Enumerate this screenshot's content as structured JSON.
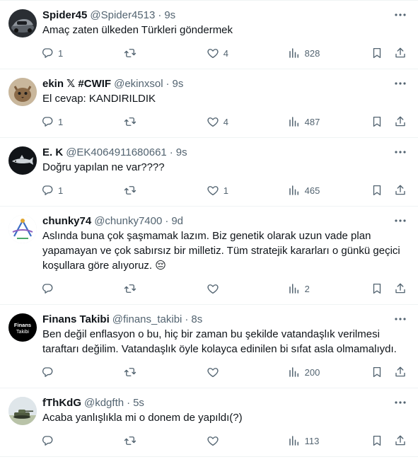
{
  "colors": {
    "text": "#0f1419",
    "secondary": "#536471",
    "divider": "#eff3f4"
  },
  "tweets": [
    {
      "name": "Spider45",
      "handle": "@Spider4513",
      "time": "9s",
      "text": "Amaç zaten ülkeden Türkleri göndermek",
      "replies": "1",
      "retweets": "",
      "likes": "4",
      "views": "828",
      "avatar_icon": "car-avatar"
    },
    {
      "name": "ekin 𝕏 #CWIF",
      "handle": "@ekinxsol",
      "time": "9s",
      "text": "El cevap: KANDIRILDIK",
      "replies": "1",
      "retweets": "",
      "likes": "4",
      "views": "487",
      "avatar_icon": "cat-avatar"
    },
    {
      "name": "E. K",
      "handle": "@EK4064911680661",
      "time": "9s",
      "text": "Doğru yapılan ne var????",
      "replies": "1",
      "retweets": "",
      "likes": "1",
      "views": "465",
      "avatar_icon": "shark-avatar"
    },
    {
      "name": "chunky74",
      "handle": "@chunky7400",
      "time": "9d",
      "text": "Aslında buna çok şaşmamak lazım. Biz genetik olarak uzun vade plan yapamayan ve çok sabırsız bir milletiz. Tüm stratejik kararları o günkü geçici koşullara göre alıyoruz. 😔",
      "replies": "",
      "retweets": "",
      "likes": "",
      "views": "2",
      "avatar_icon": "logo-avatar"
    },
    {
      "name": "Finans Takibi",
      "handle": "@finans_takibi",
      "time": "8s",
      "text": "Ben değil enflasyon o bu, hiç bir zaman bu şekilde vatandaşlık verilmesi taraftarı değilim. Vatandaşlık öyle kolayca edinilen bi sıfat asla olmamalıydı.",
      "replies": "",
      "retweets": "",
      "likes": "",
      "views": "200",
      "avatar_icon": "finans-takibi-avatar",
      "avatar_text": [
        "Finans",
        "Takibi"
      ]
    },
    {
      "name": "fThKdG",
      "handle": "@kdgfth",
      "time": "5s",
      "text": "Acaba yanlışlıkla mi o donem de yapıldı(?)",
      "replies": "",
      "retweets": "",
      "likes": "",
      "views": "113",
      "avatar_icon": "tank-avatar"
    }
  ]
}
